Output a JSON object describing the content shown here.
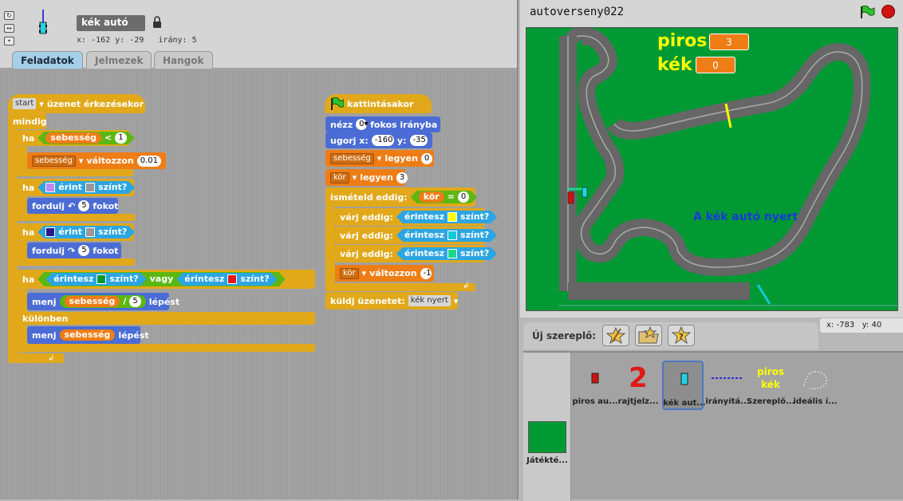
{
  "sprite_header": {
    "name": "kék autó",
    "x_label": "x:",
    "x": "-162",
    "y_label": "y:",
    "y": "-29",
    "dir_label": "irány:",
    "dir": "5"
  },
  "tabs": [
    {
      "label": "Feladatok",
      "active": true
    },
    {
      "label": "Jelmezek",
      "active": false
    },
    {
      "label": "Hangok",
      "active": false
    }
  ],
  "script1": {
    "hat_dd": "start",
    "hat_text": "üzenet érkezésekor",
    "forever": "mindig",
    "if1": "ha",
    "if1_var": "sebesség",
    "if1_op": "<",
    "if1_num": "1",
    "change_var": "sebesség",
    "change_text": "változzon",
    "change_val": "0.01",
    "if2": "ha",
    "if2_text": "érint",
    "if2_color": "színt?",
    "turn_left": "fordulj",
    "turn_left_val": "5",
    "turn_left_unit": "fokot",
    "if3": "ha",
    "if3_text": "érint",
    "if3_color": "színt?",
    "turn_right": "fordulj",
    "turn_right_val": "5",
    "turn_right_unit": "fokot",
    "ifelse": "ha",
    "touch1": "érintesz",
    "touch1_q": "színt?",
    "or": "vagy",
    "touch2": "érintesz",
    "touch2_q": "színt?",
    "move1": "menj",
    "move1_var": "sebesség",
    "move1_op": "/",
    "move1_num": "5",
    "move1_unit": "lépést",
    "else": "különben",
    "move2": "menj",
    "move2_var": "sebesség",
    "move2_unit": "lépést"
  },
  "script2": {
    "hat_text": "kattintásakor",
    "point": "nézz",
    "point_val": "0▾",
    "point_text": "fokos irányba",
    "goto": "ugorj x:",
    "goto_x": "-160",
    "goto_y_label": "y:",
    "goto_y": "-35",
    "set1_var": "sebesség",
    "set1_text": "legyen",
    "set1_val": "0",
    "set2_var": "kör",
    "set2_text": "legyen",
    "set2_val": "3",
    "repeat": "ismételd eddig:",
    "rep_var": "kör",
    "rep_op": "=",
    "rep_val": "0",
    "wait": "várj eddig:",
    "touch": "érintesz",
    "q": "színt?",
    "change_var": "kör",
    "change_text": "változzon",
    "change_val": "-1",
    "broadcast": "küldj üzenetet:",
    "broadcast_msg": "kék nyert"
  },
  "stage": {
    "title": "autoverseny022",
    "score_red_label": "piros",
    "score_red": "3",
    "score_blue_label": "kék",
    "score_blue": "0",
    "winner_text": "A kék autó nyert"
  },
  "mouse": {
    "x_label": "x:",
    "x": "-783",
    "y_label": "y:",
    "y": "40"
  },
  "new_sprite": {
    "label": "Új szereplő:"
  },
  "sprites": [
    {
      "label": "piros au..."
    },
    {
      "label": "rajtjelz..."
    },
    {
      "label": "kék aut..."
    },
    {
      "label": "irányítá..."
    },
    {
      "label": "Szereplő..."
    },
    {
      "label": "ideális í..."
    }
  ],
  "sprite_thumb_text": {
    "two": "2",
    "piros": "piros",
    "kek": "kék"
  },
  "stage_thumb": {
    "label": "Játékté..."
  },
  "colors": {
    "control": "#e1a91a",
    "motion": "#4a6cd4",
    "variables": "#ee7d16",
    "sensing": "#2ca5e2",
    "operators": "#5cb712",
    "stage_green": "#009933",
    "track": "#666666",
    "swatch_purple_light": "#b98cf0",
    "swatch_gray": "#999999",
    "swatch_navy": "#2a1a8e",
    "swatch_green": "#009933",
    "swatch_red": "#e01818",
    "swatch_yellow": "#ffff00",
    "swatch_cyan": "#17c8d8",
    "swatch_teal": "#1bd88a"
  }
}
